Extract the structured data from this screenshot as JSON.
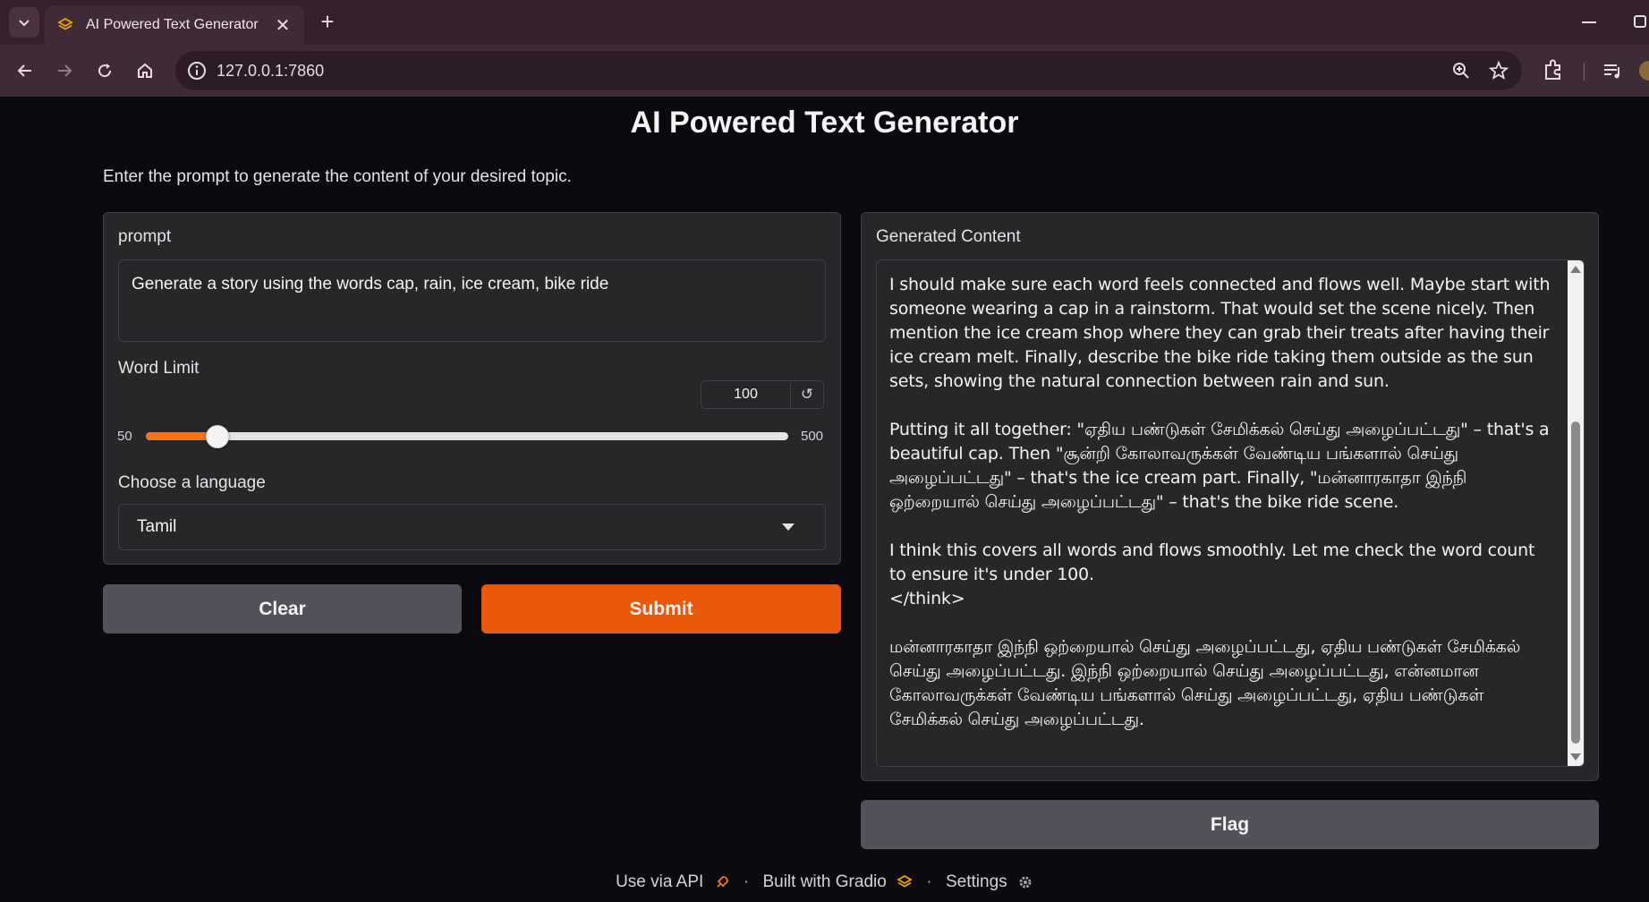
{
  "browser": {
    "tab_title": "AI Powered Text Generator",
    "url": "127.0.0.1:7860",
    "new_tab_label": "+",
    "close_tab_label": "✕"
  },
  "page": {
    "title": "AI Powered Text Generator",
    "description": "Enter the prompt to generate the content of your desired topic."
  },
  "inputs": {
    "prompt_label": "prompt",
    "prompt_value": "Generate a story using the words cap, rain, ice cream, bike ride",
    "word_limit_label": "Word Limit",
    "word_limit_value": "100",
    "word_limit_reset": "↺",
    "word_limit_min": "50",
    "word_limit_max": "500",
    "word_limit_fraction": 0.111,
    "language_label": "Choose a language",
    "language_value": "Tamil"
  },
  "buttons": {
    "clear": "Clear",
    "submit": "Submit",
    "flag": "Flag"
  },
  "output": {
    "label": "Generated Content",
    "text": "I should make sure each word feels connected and flows well. Maybe start with someone wearing a cap in a rainstorm. That would set the scene nicely. Then mention the ice cream shop where they can grab their treats after having their ice cream melt. Finally, describe the bike ride taking them outside as the sun sets, showing the natural connection between rain and sun.\n\nPutting it all together: \"ஏதிய பண்டுகள் சேமிக்கல் செய்து அழைப்பட்டது\" – that's a beautiful cap. Then \"சூன்றி கோலாவருக்கள் வேண்டிய பங்களால் செய்து அழைப்பட்டது\" – that's the ice cream part. Finally, \"மன்னாரகாதா இந்நி ஒற்றையால் செய்து அழைப்பட்டது\" – that's the bike ride scene.\n\nI think this covers all words and flows smoothly. Let me check the word count to ensure it's under 100.\n</think>\n\nமன்னாரகாதா இந்நி ஒற்றையால் செய்து அழைப்பட்டது, ஏதிய பண்டுகள் சேமிக்கல் செய்து அழைப்பட்டது. இந்நி ஒற்றையால் செய்து அழைப்பட்டது, என்னமான கோலாவருக்கள் வேண்டிய பங்களால் செய்து அழைப்பட்டது, ஏதிய பண்டுகள் சேமிக்கல் செய்து அழைப்பட்டது."
  },
  "footer": {
    "api": "Use via API",
    "gradio": "Built with Gradio",
    "settings": "Settings",
    "separator": "·"
  },
  "colors": {
    "accent": "#f97316",
    "submit": "#ea580c",
    "panel": "#27272a",
    "background": "#0b0b0f"
  }
}
